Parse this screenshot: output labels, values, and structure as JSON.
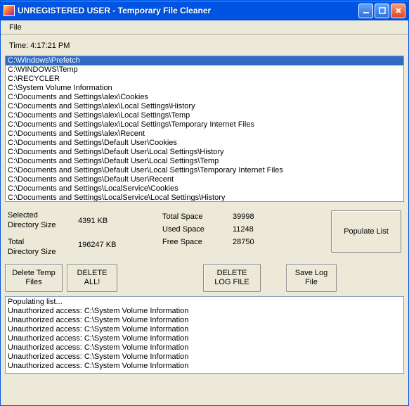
{
  "titlebar": {
    "title": "UNREGISTERED USER - Temporary File Cleaner"
  },
  "menu": {
    "file": "File"
  },
  "time": {
    "label": "Time: 4:17:21 PM"
  },
  "directories": [
    "C:\\Windows\\Prefetch",
    "C:\\WINDOWS\\Temp",
    "C:\\RECYCLER",
    "C:\\System Volume Information",
    "C:\\Documents and Settings\\alex\\Cookies",
    "C:\\Documents and Settings\\alex\\Local Settings\\History",
    "C:\\Documents and Settings\\alex\\Local Settings\\Temp",
    "C:\\Documents and Settings\\alex\\Local Settings\\Temporary Internet Files",
    "C:\\Documents and Settings\\alex\\Recent",
    "C:\\Documents and Settings\\Default User\\Cookies",
    "C:\\Documents and Settings\\Default User\\Local Settings\\History",
    "C:\\Documents and Settings\\Default User\\Local Settings\\Temp",
    "C:\\Documents and Settings\\Default User\\Local Settings\\Temporary Internet Files",
    "C:\\Documents and Settings\\Default User\\Recent",
    "C:\\Documents and Settings\\LocalService\\Cookies",
    "C:\\Documents and Settings\\LocalService\\Local Settings\\History"
  ],
  "stats": {
    "selected_dir_size_label": "Selected\nDirectory Size",
    "selected_dir_size_value": "4391 KB",
    "total_dir_size_label": "Total\nDirectory Size",
    "total_dir_size_value": "196247 KB",
    "total_space_label": "Total Space",
    "total_space_value": "39998",
    "used_space_label": "Used Space",
    "used_space_value": "11248",
    "free_space_label": "Free Space",
    "free_space_value": "28750"
  },
  "buttons": {
    "populate": "Populate List",
    "delete_temp": "Delete Temp\nFiles",
    "delete_all": "DELETE\nALL!",
    "delete_log": "DELETE\nLOG FILE",
    "save_log": "Save Log\nFile"
  },
  "log": [
    "Populating list...",
    "Unauthorized access: C:\\System Volume Information",
    "Unauthorized access: C:\\System Volume Information",
    "Unauthorized access: C:\\System Volume Information",
    "Unauthorized access: C:\\System Volume Information",
    "Unauthorized access: C:\\System Volume Information",
    "Unauthorized access: C:\\System Volume Information",
    "Unauthorized access: C:\\System Volume Information"
  ]
}
